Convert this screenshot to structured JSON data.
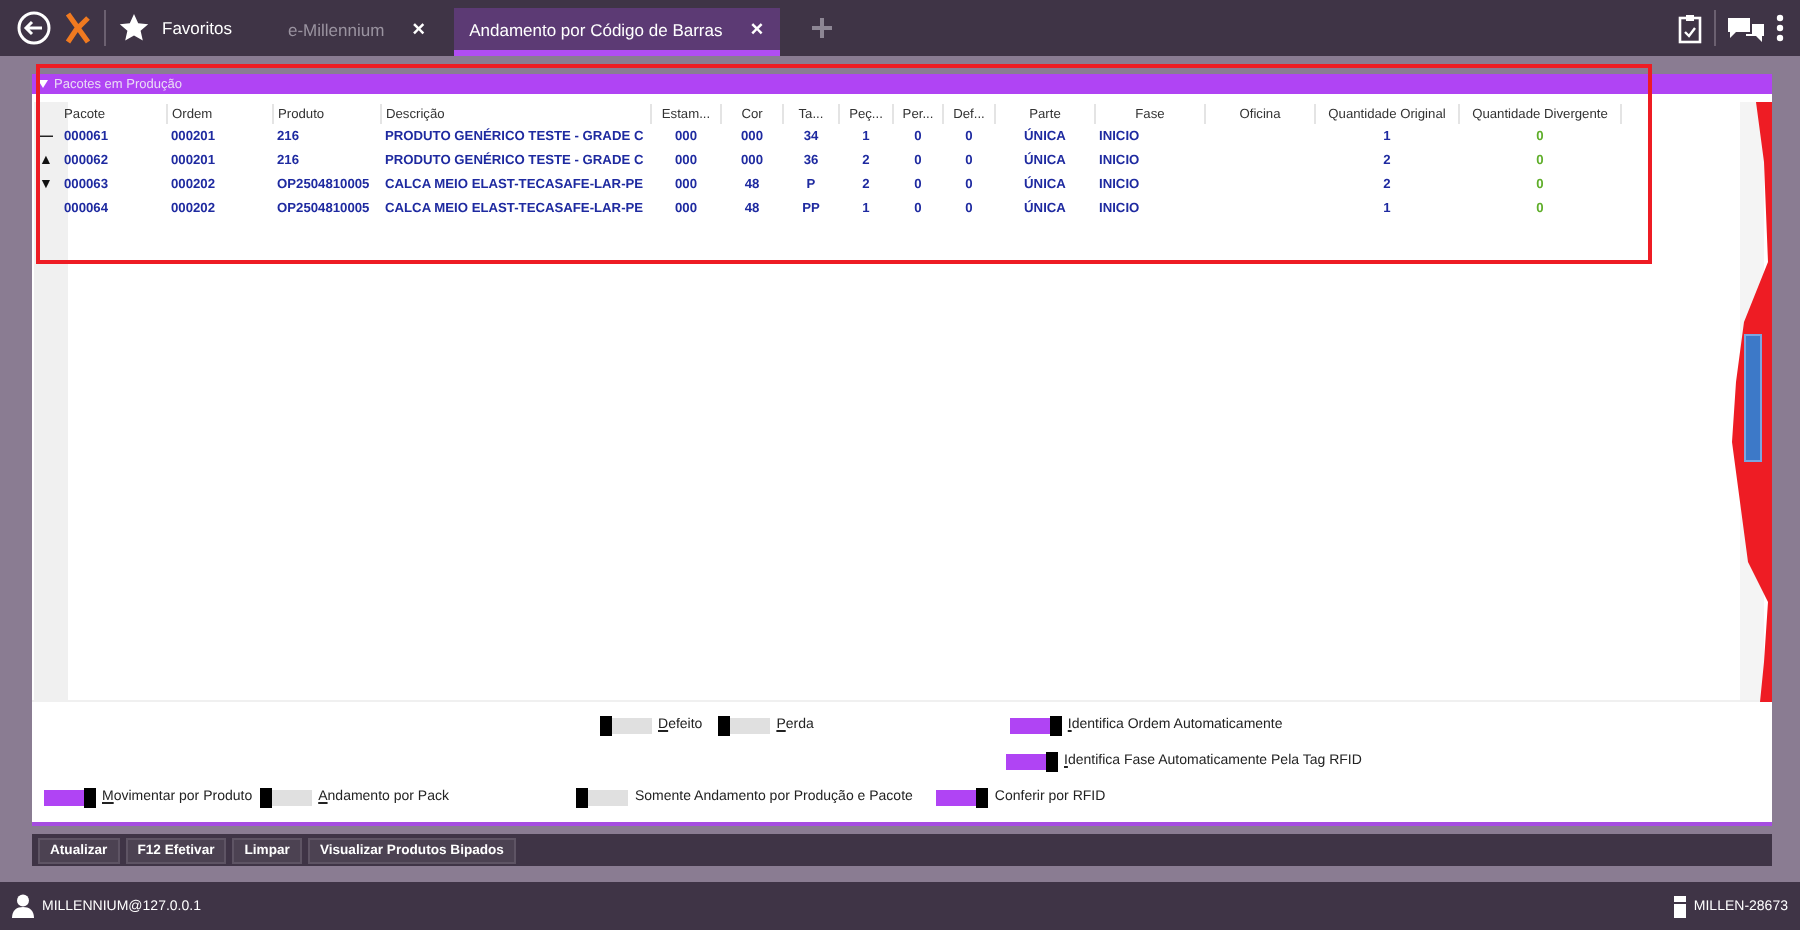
{
  "toolbar": {
    "favorites": "Favoritos"
  },
  "tabs": [
    {
      "label": "e-Millennium",
      "close": "×",
      "selected": false
    },
    {
      "label": "Andamento por Código de Barras",
      "close": "×",
      "selected": true
    }
  ],
  "panel": {
    "title": "Pacotes em Produção",
    "expanded": true
  },
  "table": {
    "columns": [
      "Pacote",
      "Ordem",
      "Produto",
      "Descrição",
      "Estam...",
      "Cor",
      "Ta...",
      "Peç...",
      "Per...",
      "Def...",
      "Parte",
      "Fase",
      "Oficina",
      "Quantidade Original",
      "Quantidade Divergente"
    ],
    "rows": [
      {
        "indicator": "—",
        "cells": [
          "000061",
          "000201",
          "216",
          "PRODUTO GENÉRICO TESTE - GRADE C",
          "000",
          "000",
          "34",
          "1",
          "0",
          "0",
          "ÚNICA",
          "INICIO",
          "",
          "1",
          "0"
        ]
      },
      {
        "indicator": "▲",
        "cells": [
          "000062",
          "000201",
          "216",
          "PRODUTO GENÉRICO TESTE - GRADE C",
          "000",
          "000",
          "36",
          "2",
          "0",
          "0",
          "ÚNICA",
          "INICIO",
          "",
          "2",
          "0"
        ]
      },
      {
        "indicator": "▼",
        "cells": [
          "000063",
          "000202",
          "OP2504810005",
          "CALCA MEIO ELAST-TECASAFE-LAR-PE",
          "000",
          "48",
          "P",
          "2",
          "0",
          "0",
          "ÚNICA",
          "INICIO",
          "",
          "2",
          "0"
        ]
      },
      {
        "indicator": "",
        "cells": [
          "000064",
          "000202",
          "OP2504810005",
          "CALCA MEIO ELAST-TECASAFE-LAR-PE",
          "000",
          "48",
          "PP",
          "1",
          "0",
          "0",
          "ÚNICA",
          "INICIO",
          "",
          "1",
          "0"
        ]
      }
    ]
  },
  "option_rows": [
    [
      {
        "label": "Defeito",
        "on": false,
        "underline_first": true
      },
      {
        "label": "Perda",
        "on": false,
        "underline_first": true
      },
      {
        "label": "Identifica Ordem Automaticamente",
        "on": true,
        "underline_first": true
      }
    ],
    [
      {
        "label": "Identifica Fase Automaticamente Pela Tag RFID",
        "on": true,
        "underline_first": true
      }
    ],
    [
      {
        "label": "Movimentar por Produto",
        "on": true,
        "underline_first": true
      },
      {
        "label": "Andamento por Pack",
        "on": false,
        "underline_first": true
      },
      {
        "label": "Somente Andamento por Produção e Pacote",
        "on": false,
        "underline_first": false
      },
      {
        "label": "Conferir por RFID",
        "on": true,
        "underline_first": false
      }
    ]
  ],
  "buttons": [
    "Atualizar",
    "F12 Efetivar",
    "Limpar",
    "Visualizar Produtos Bipados"
  ],
  "status_bar": {
    "user": "MILLENNIUM@127.0.0.1",
    "machine": "MILLEN-28673"
  }
}
